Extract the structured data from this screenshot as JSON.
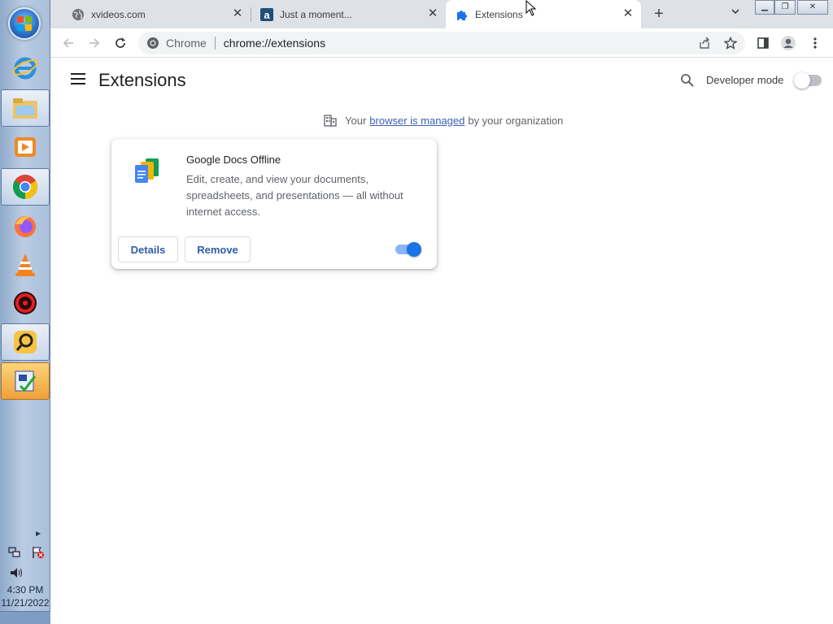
{
  "taskbar": {
    "apps": [
      {
        "name": "internet-explorer"
      },
      {
        "name": "file-explorer"
      },
      {
        "name": "media-player"
      },
      {
        "name": "chrome"
      },
      {
        "name": "firefox"
      },
      {
        "name": "vlc"
      },
      {
        "name": "red-app"
      },
      {
        "name": "search-app"
      },
      {
        "name": "checklist-app"
      }
    ],
    "clock_time": "4:30 PM",
    "clock_date": "11/21/2022"
  },
  "tabs": [
    {
      "title": "xvideos.com",
      "icon": "globe-icon"
    },
    {
      "title": "Just a moment...",
      "icon": "a-favicon"
    },
    {
      "title": "Extensions",
      "icon": "puzzle-icon"
    }
  ],
  "toolbar": {
    "chip_label": "Chrome",
    "url": "chrome://extensions"
  },
  "page": {
    "title": "Extensions",
    "developer_mode_label": "Developer mode",
    "developer_mode_on": false,
    "managed_prefix": "Your",
    "managed_link": "browser is managed",
    "managed_suffix": "by your organization"
  },
  "extension": {
    "name": "Google Docs Offline",
    "description": "Edit, create, and view your documents, spreadsheets, and presentations — all without internet access.",
    "details_label": "Details",
    "remove_label": "Remove",
    "enabled": true
  },
  "colors": {
    "accent": "#1a73e8",
    "toggle_track_on": "#8ab4f8"
  }
}
